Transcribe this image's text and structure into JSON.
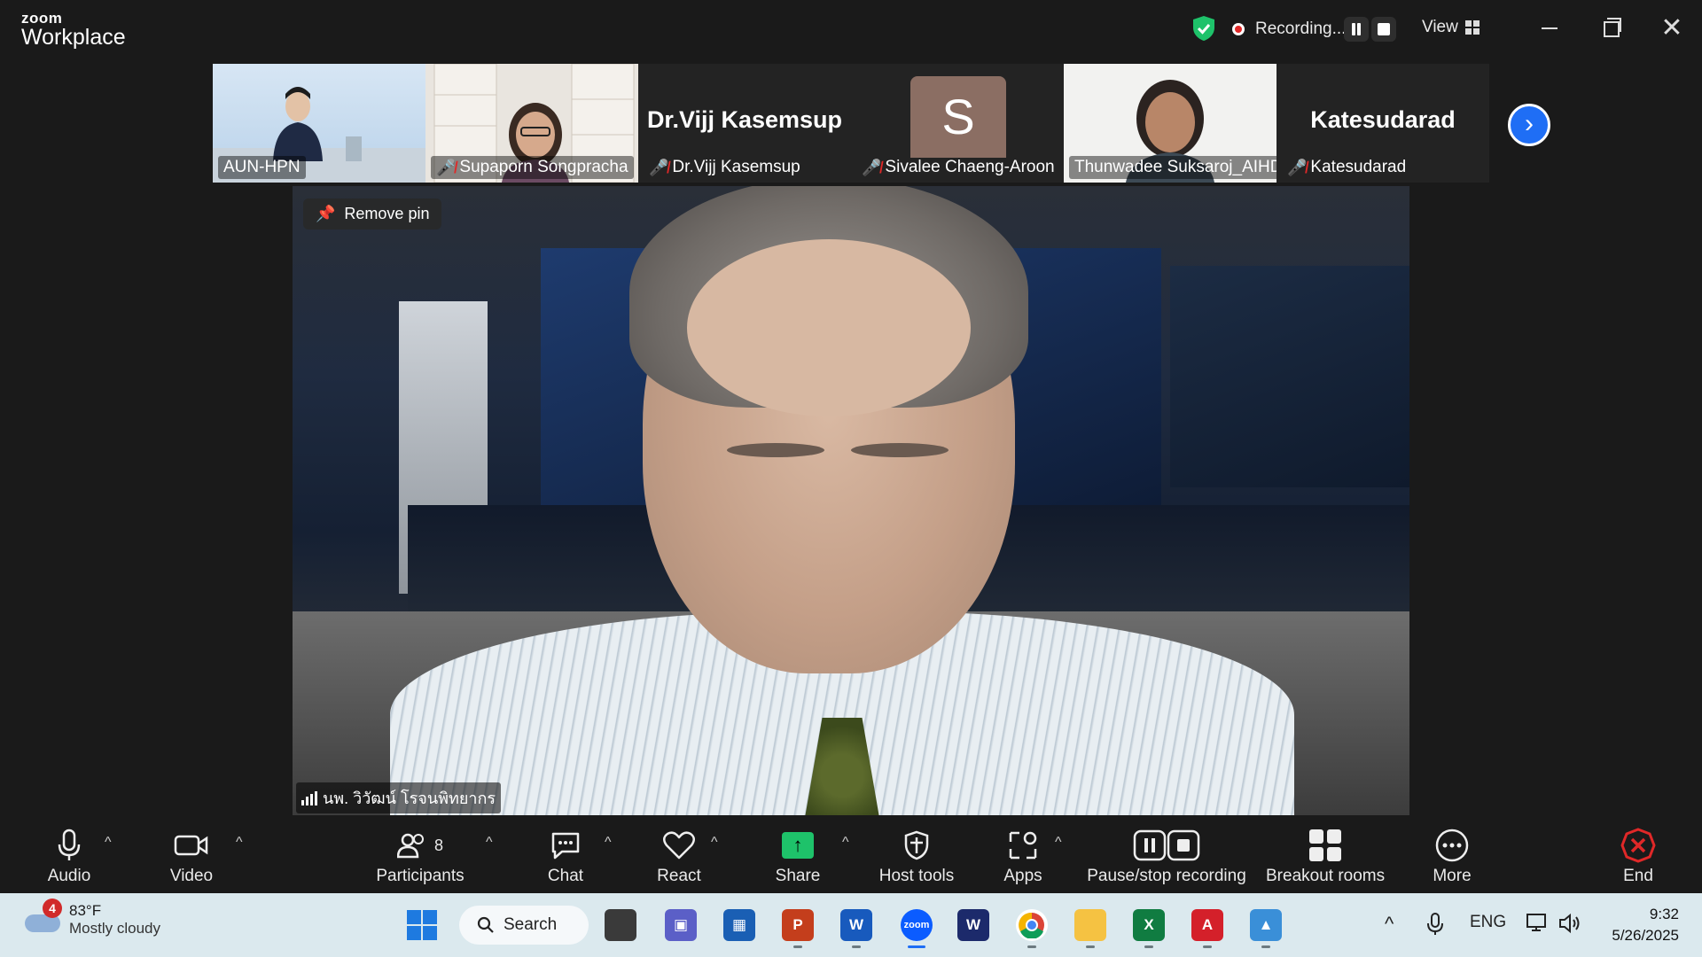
{
  "titlebar": {
    "logo_small": "zoom",
    "logo_big": "Workplace",
    "recording_text": "Recording...",
    "view_label": "View"
  },
  "gallery": {
    "tiles": [
      {
        "name": "AUN-HPN",
        "muted": false
      },
      {
        "name": "Supaporn Songpracha",
        "muted": true
      },
      {
        "display": "Dr.Vijj Kasemsup",
        "name": "Dr.Vijj Kasemsup",
        "muted": true
      },
      {
        "avatar_letter": "S",
        "name": "Sivalee Chaeng-Aroon",
        "muted": true
      },
      {
        "name": "Thunwadee  Suksaroj_AIHD",
        "muted": false
      },
      {
        "display": "Katesudarad",
        "name": "Katesudarad",
        "muted": true
      }
    ]
  },
  "main_video": {
    "pin_label": "Remove pin",
    "speaker_name": "นพ. วิวัฒน์ โรจนพิทยากร"
  },
  "toolbar": {
    "audio": "Audio",
    "video": "Video",
    "participants": "Participants",
    "participants_count": "8",
    "chat": "Chat",
    "react": "React",
    "share": "Share",
    "host_tools": "Host tools",
    "apps": "Apps",
    "pause_stop": "Pause/stop recording",
    "breakout": "Breakout rooms",
    "more": "More",
    "end": "End"
  },
  "taskbar": {
    "weather_badge": "4",
    "weather_temp": "83°F",
    "weather_desc": "Mostly cloudy",
    "search_label": "Search",
    "lang": "ENG",
    "time": "9:32",
    "date": "5/26/2025"
  },
  "colors": {
    "accent_blue": "#1f6ef5",
    "share_green": "#1ec26a",
    "end_red": "#e02828",
    "toolbar_bg": "#1a1a1a",
    "taskbar_bg": "#dbe9ee"
  }
}
